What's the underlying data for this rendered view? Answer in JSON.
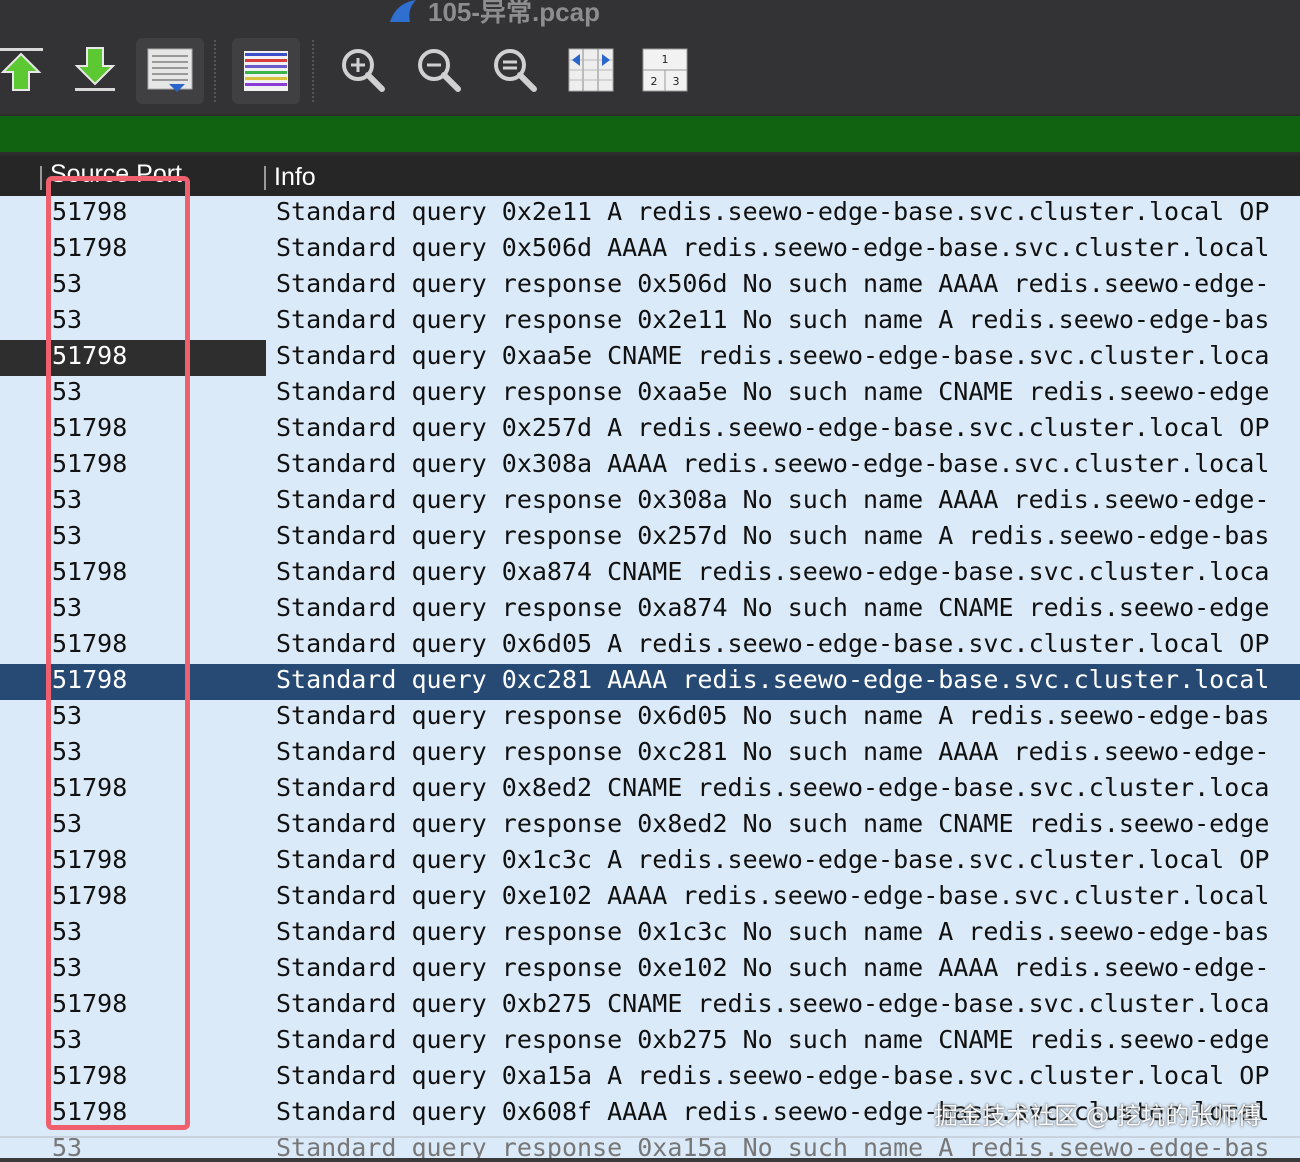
{
  "window": {
    "title": "105-异常.pcap"
  },
  "toolbar": {
    "buttons": [
      {
        "name": "go-to-first-packet",
        "icon": "arrow-up-green-icon"
      },
      {
        "name": "go-to-last-packet",
        "icon": "arrow-down-green-icon"
      },
      {
        "name": "auto-scroll",
        "icon": "autoscroll-icon"
      },
      {
        "name": "colorize",
        "icon": "colorize-lines-icon"
      },
      {
        "name": "zoom-in",
        "icon": "zoom-in-icon"
      },
      {
        "name": "zoom-out",
        "icon": "zoom-out-icon"
      },
      {
        "name": "normal-size",
        "icon": "zoom-reset-icon"
      },
      {
        "name": "resize-columns",
        "icon": "resize-columns-icon"
      },
      {
        "name": "layout-panes",
        "icon": "pane-layout-icon",
        "labels": [
          "1",
          "2",
          "3"
        ]
      }
    ]
  },
  "filter_bar": {
    "color": "#116311"
  },
  "columns": {
    "source_port": "Source Port",
    "info": "Info"
  },
  "colors": {
    "row_bg": "#dbeaf9",
    "selected": "#274a75",
    "highlight_box": "#ef5f6e"
  },
  "rows": [
    {
      "port": "51798",
      "info": "Standard query 0x2e11 A redis.seewo-edge-base.svc.cluster.local OP"
    },
    {
      "port": "51798",
      "info": "Standard query 0x506d AAAA redis.seewo-edge-base.svc.cluster.local"
    },
    {
      "port": "53",
      "info": "Standard query response 0x506d No such name AAAA redis.seewo-edge-"
    },
    {
      "port": "53",
      "info": "Standard query response 0x2e11 No such name A redis.seewo-edge-bas"
    },
    {
      "port": "51798",
      "info": "Standard query 0xaa5e CNAME redis.seewo-edge-base.svc.cluster.loca"
    },
    {
      "port": "53",
      "info": "Standard query response 0xaa5e No such name CNAME redis.seewo-edge"
    },
    {
      "port": "51798",
      "info": "Standard query 0x257d A redis.seewo-edge-base.svc.cluster.local OP"
    },
    {
      "port": "51798",
      "info": "Standard query 0x308a AAAA redis.seewo-edge-base.svc.cluster.local"
    },
    {
      "port": "53",
      "info": "Standard query response 0x308a No such name AAAA redis.seewo-edge-"
    },
    {
      "port": "53",
      "info": "Standard query response 0x257d No such name A redis.seewo-edge-bas"
    },
    {
      "port": "51798",
      "info": "Standard query 0xa874 CNAME redis.seewo-edge-base.svc.cluster.loca"
    },
    {
      "port": "53",
      "info": "Standard query response 0xa874 No such name CNAME redis.seewo-edge"
    },
    {
      "port": "51798",
      "info": "Standard query 0x6d05 A redis.seewo-edge-base.svc.cluster.local OP"
    },
    {
      "port": "51798",
      "info": "Standard query 0xc281 AAAA redis.seewo-edge-base.svc.cluster.local"
    },
    {
      "port": "53",
      "info": "Standard query response 0x6d05 No such name A redis.seewo-edge-bas"
    },
    {
      "port": "53",
      "info": "Standard query response 0xc281 No such name AAAA redis.seewo-edge-"
    },
    {
      "port": "51798",
      "info": "Standard query 0x8ed2 CNAME redis.seewo-edge-base.svc.cluster.loca"
    },
    {
      "port": "53",
      "info": "Standard query response 0x8ed2 No such name CNAME redis.seewo-edge"
    },
    {
      "port": "51798",
      "info": "Standard query 0x1c3c A redis.seewo-edge-base.svc.cluster.local OP"
    },
    {
      "port": "51798",
      "info": "Standard query 0xe102 AAAA redis.seewo-edge-base.svc.cluster.local"
    },
    {
      "port": "53",
      "info": "Standard query response 0x1c3c No such name A redis.seewo-edge-bas"
    },
    {
      "port": "53",
      "info": "Standard query response 0xe102 No such name AAAA redis.seewo-edge-"
    },
    {
      "port": "51798",
      "info": "Standard query 0xb275 CNAME redis.seewo-edge-base.svc.cluster.loca"
    },
    {
      "port": "53",
      "info": "Standard query response 0xb275 No such name CNAME redis.seewo-edge"
    },
    {
      "port": "51798",
      "info": "Standard query 0xa15a A redis.seewo-edge-base.svc.cluster.local OP"
    },
    {
      "port": "51798",
      "info": "Standard query 0x608f AAAA redis.seewo-edge-base.svc.cluster.local"
    },
    {
      "port": "53",
      "info": "Standard query response 0xa15a No such name A redis.seewo-edge-bas"
    }
  ],
  "focused_row_index": 4,
  "selected_row_index": 13,
  "watermark": "掘金技术社区 @ 挖坑的张师傅"
}
